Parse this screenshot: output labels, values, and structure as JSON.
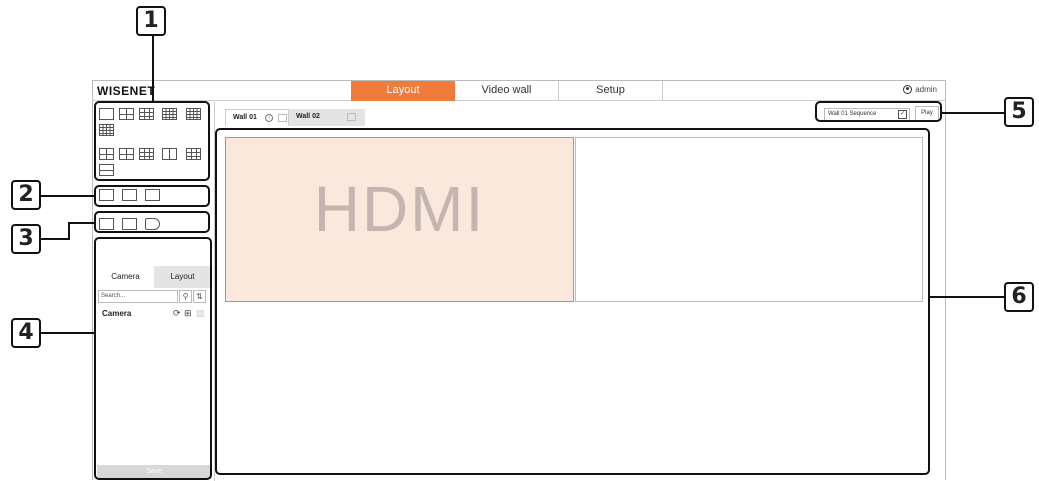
{
  "callouts": {
    "c1": "1",
    "c2": "2",
    "c3": "3",
    "c4": "4",
    "c5": "5",
    "c6": "6"
  },
  "header": {
    "logo": "WISENET",
    "tabs": [
      "Layout",
      "Video wall",
      "Setup"
    ],
    "active_tab": "Layout",
    "user": "admin",
    "accent_color": "#f07c3c"
  },
  "left_panel": {
    "tabs": [
      "Camera",
      "Layout"
    ],
    "search_placeholder": "Search...",
    "camera_group": "Camera",
    "save_label": "Save"
  },
  "main": {
    "wall_tabs": [
      "Wall 01",
      "Wall 02"
    ],
    "sequence_select": "Wall 01 Sequence",
    "play_label": "Play",
    "screen_label": "HDMI"
  }
}
